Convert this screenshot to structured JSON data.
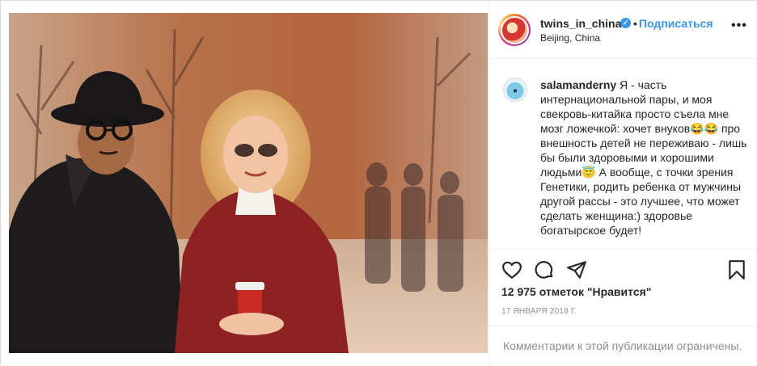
{
  "header": {
    "username": "twins_in_china",
    "verified_icon": "verified-badge-icon",
    "separator": "•",
    "follow_label": "Подписаться",
    "location": "Beijing, China",
    "more_label": "•••"
  },
  "comment": {
    "username": "salamanderny",
    "text": "Я - часть интернациональной пары, и моя свекровь-китайка просто съела мне мозг ложечкой: хочет внуков😂😂 про внешность детей не переживаю - лишь бы были здоровыми и хорошими людьми😇 А вообще, с точки зрения Генетики, родить ребенка от мужчины другой рассы - это лучшее, что может сделать женщина:) здоровье богатырское будет!"
  },
  "actions": {
    "like_icon": "heart-icon",
    "comment_icon": "comment-icon",
    "share_icon": "share-icon",
    "save_icon": "bookmark-icon"
  },
  "likes_text": "12 975 отметок \"Нравится\"",
  "date_text": "17 ЯНВАРЯ 2018 Г.",
  "comments_restricted": "Комментарии к этой публикации ограничены.",
  "colors": {
    "accent": "#3897f0",
    "text": "#262626",
    "muted": "#8e8e8e",
    "border": "#dbdbdb"
  }
}
